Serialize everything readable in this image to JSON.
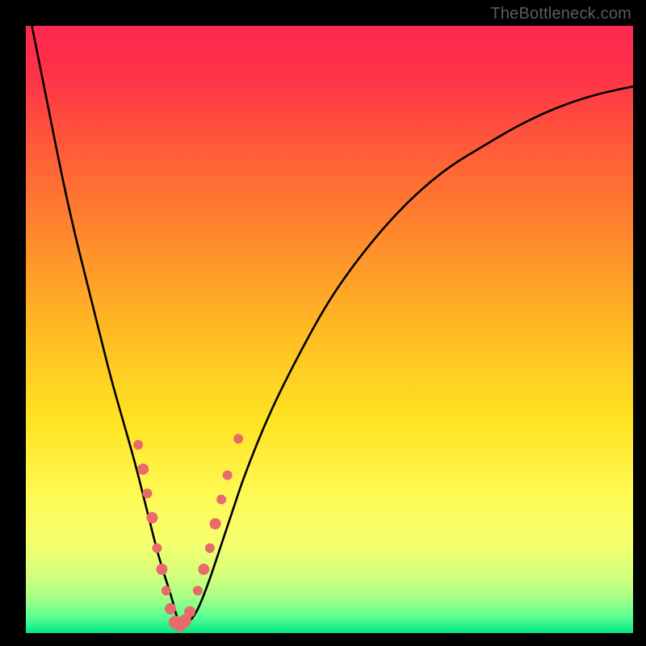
{
  "watermark": "TheBottleneck.com",
  "gradient_stops": [
    {
      "offset": 0.0,
      "color": "#ff2850"
    },
    {
      "offset": 0.08,
      "color": "#ff3249"
    },
    {
      "offset": 0.2,
      "color": "#ff5b39"
    },
    {
      "offset": 0.35,
      "color": "#ff8a2c"
    },
    {
      "offset": 0.5,
      "color": "#ffba24"
    },
    {
      "offset": 0.65,
      "color": "#ffe322"
    },
    {
      "offset": 0.77,
      "color": "#fff953"
    },
    {
      "offset": 0.85,
      "color": "#f5ff6e"
    },
    {
      "offset": 0.9,
      "color": "#d8ff7a"
    },
    {
      "offset": 0.94,
      "color": "#aaff86"
    },
    {
      "offset": 0.975,
      "color": "#55ff90"
    },
    {
      "offset": 1.0,
      "color": "#00e884"
    }
  ],
  "chart_data": {
    "type": "line",
    "title": "",
    "xlabel": "",
    "ylabel": "",
    "xlim": [
      0,
      100
    ],
    "ylim": [
      0,
      100
    ],
    "series": [
      {
        "name": "curve",
        "x": [
          0,
          2,
          4,
          6,
          8,
          10,
          12,
          14,
          16,
          18,
          20,
          22,
          24,
          25,
          26,
          28,
          30,
          32,
          34,
          36,
          40,
          45,
          50,
          55,
          60,
          65,
          70,
          75,
          80,
          85,
          90,
          95,
          100
        ],
        "y": [
          105,
          95,
          85,
          75,
          66,
          58,
          50,
          42,
          35,
          28,
          20,
          12,
          6,
          2,
          1,
          3,
          8,
          14,
          20,
          26,
          36,
          46,
          55,
          62,
          68,
          73,
          77,
          80,
          83,
          85.5,
          87.5,
          89,
          90
        ],
        "note": "y is plotted as height above bottom; curve dips to ~0 near x≈25 and rises on both sides (V-shape)."
      }
    ],
    "markers": [
      {
        "x": 18.5,
        "y": 31,
        "r": 6
      },
      {
        "x": 19.3,
        "y": 27,
        "r": 7
      },
      {
        "x": 20.0,
        "y": 23,
        "r": 6
      },
      {
        "x": 20.8,
        "y": 19,
        "r": 7
      },
      {
        "x": 21.6,
        "y": 14,
        "r": 6
      },
      {
        "x": 22.4,
        "y": 10.5,
        "r": 7
      },
      {
        "x": 23.1,
        "y": 7,
        "r": 6
      },
      {
        "x": 23.8,
        "y": 4,
        "r": 7
      },
      {
        "x": 24.6,
        "y": 1.8,
        "r": 8
      },
      {
        "x": 25.4,
        "y": 1.3,
        "r": 8
      },
      {
        "x": 26.2,
        "y": 2,
        "r": 8
      },
      {
        "x": 27.0,
        "y": 3.5,
        "r": 7
      },
      {
        "x": 28.3,
        "y": 7,
        "r": 6
      },
      {
        "x": 29.3,
        "y": 10.5,
        "r": 7
      },
      {
        "x": 30.3,
        "y": 14,
        "r": 6
      },
      {
        "x": 31.2,
        "y": 18,
        "r": 7
      },
      {
        "x": 32.2,
        "y": 22,
        "r": 6
      },
      {
        "x": 33.2,
        "y": 26,
        "r": 6
      },
      {
        "x": 35.0,
        "y": 32,
        "r": 6
      }
    ],
    "marker_color": "#e86a6a"
  }
}
